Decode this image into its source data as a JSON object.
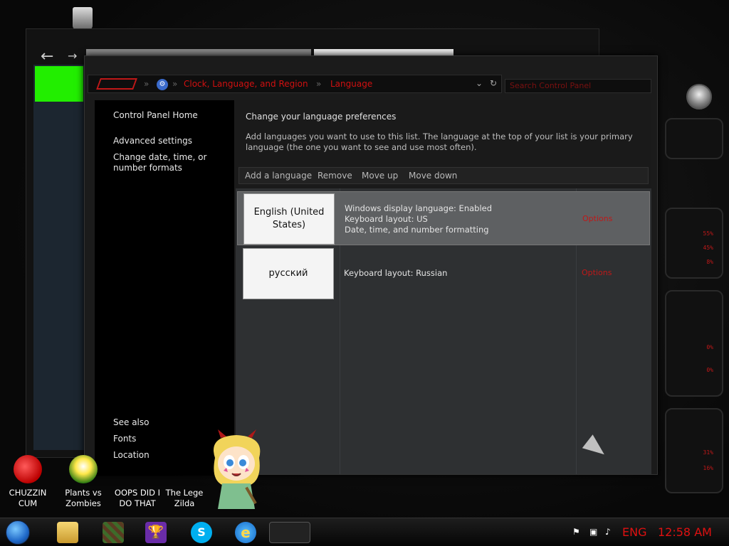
{
  "window": {
    "breadcrumb": [
      "Clock, Language, and Region",
      "Language"
    ],
    "search_placeholder": "Search Control Panel"
  },
  "left_pane": {
    "links": [
      "Control Panel Home",
      "Advanced settings",
      "Change date, time, or number formats"
    ],
    "see_also_title": "See also",
    "see_also_links": [
      "Fonts",
      "Location"
    ]
  },
  "content": {
    "heading": "Change your language preferences",
    "description": "Add languages you want to use to this list. The language at the top of your list is your primary language (the one you want to see and use most often).",
    "toolbar": [
      "Add a language",
      "Remove",
      "Move up",
      "Move down"
    ],
    "languages": [
      {
        "name": "English (United States)",
        "details": [
          "Windows display language: Enabled",
          "Keyboard layout: US",
          "Date, time, and number formatting"
        ],
        "options": "Options",
        "selected": true
      },
      {
        "name": "русский",
        "details": [
          "Keyboard layout: Russian"
        ],
        "options": "Options",
        "selected": false
      }
    ]
  },
  "desktop_icons": [
    {
      "label": "CHUZZIN CUM",
      "icon": "chuzzle-icon"
    },
    {
      "label": "Plants vs Zombies",
      "icon": "plants-vs-zombies-icon"
    },
    {
      "label": "OOPS DID I DO THAT",
      "icon": "shortcut-icon"
    },
    {
      "label": "The Lege Zilda",
      "icon": "zelda-icon"
    }
  ],
  "taskbar": {
    "language": "ENG",
    "time": "12:58 AM",
    "pinned": [
      "explorer-icon",
      "minecraft-icon",
      "trophy-icon",
      "skype-icon",
      "internet-explorer-icon",
      "alienware-icon"
    ]
  },
  "colors": {
    "accent_red": "#d01010",
    "window_bg": "#1b1b1b",
    "selected_row": "#5e6062"
  }
}
